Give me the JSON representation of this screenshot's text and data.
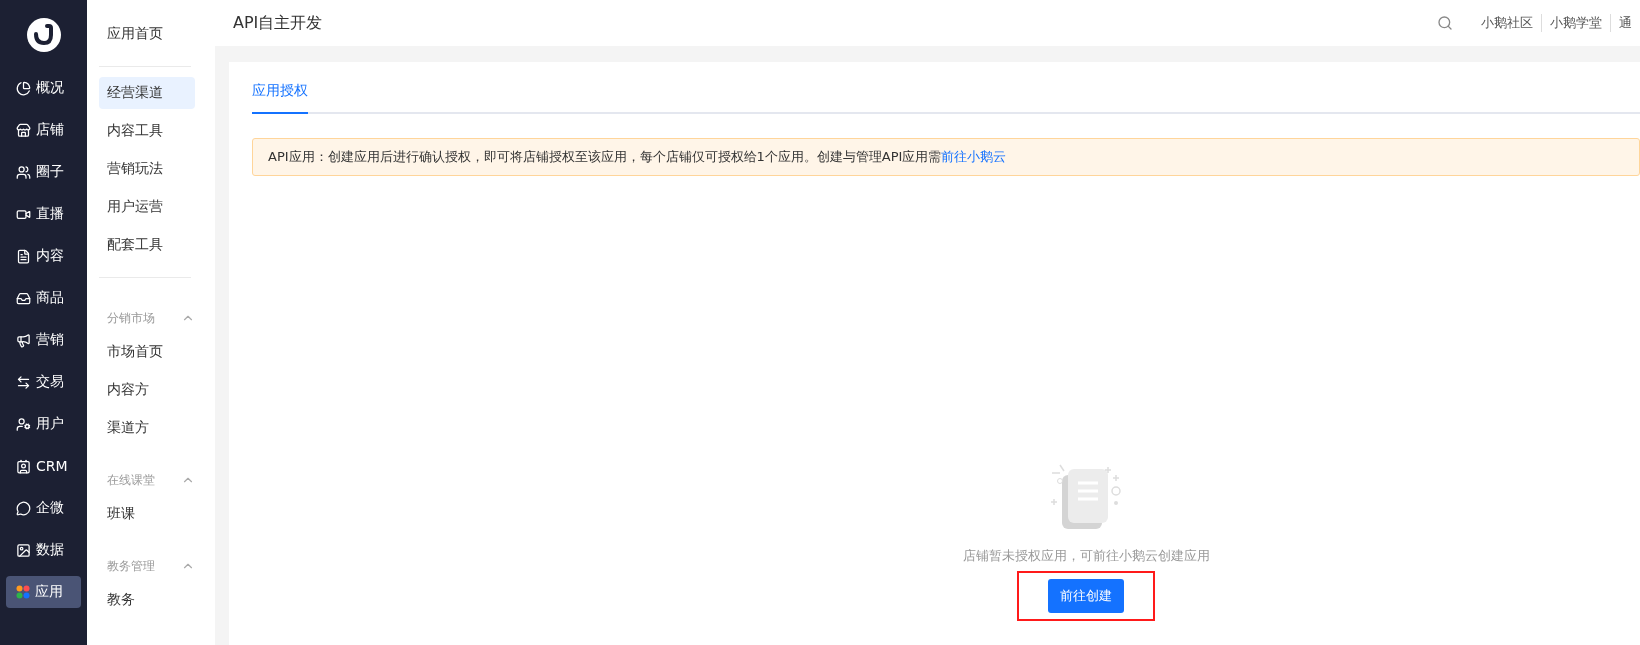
{
  "rail": {
    "items": [
      {
        "label": "概况",
        "selected": false
      },
      {
        "label": "店铺",
        "selected": false
      },
      {
        "label": "圈子",
        "selected": false
      },
      {
        "label": "直播",
        "selected": false
      },
      {
        "label": "内容",
        "selected": false
      },
      {
        "label": "商品",
        "selected": false
      },
      {
        "label": "营销",
        "selected": false
      },
      {
        "label": "交易",
        "selected": false
      },
      {
        "label": "用户",
        "selected": false
      },
      {
        "label": "CRM",
        "selected": false
      },
      {
        "label": "企微",
        "selected": false
      },
      {
        "label": "数据",
        "selected": false
      },
      {
        "label": "应用",
        "selected": true
      }
    ]
  },
  "sidebar": {
    "groups": [
      {
        "items": [
          {
            "label": "应用首页",
            "selected": false
          }
        ]
      },
      {
        "items": [
          {
            "label": "经营渠道",
            "selected": true
          },
          {
            "label": "内容工具",
            "selected": false
          },
          {
            "label": "营销玩法",
            "selected": false
          },
          {
            "label": "用户运营",
            "selected": false
          },
          {
            "label": "配套工具",
            "selected": false
          }
        ]
      },
      {
        "title": "分销市场",
        "expanded": true,
        "items": [
          {
            "label": "市场首页",
            "selected": false
          },
          {
            "label": "内容方",
            "selected": false
          },
          {
            "label": "渠道方",
            "selected": false
          }
        ]
      },
      {
        "title": "在线课堂",
        "expanded": true,
        "items": [
          {
            "label": "班课",
            "selected": false
          }
        ]
      },
      {
        "title": "教务管理",
        "expanded": true,
        "items": [
          {
            "label": "教务",
            "selected": false
          }
        ]
      }
    ]
  },
  "header": {
    "title": "API自主开发",
    "links": [
      "小鹅社区",
      "小鹅学堂",
      "通"
    ]
  },
  "tabs": [
    {
      "label": "应用授权",
      "selected": true
    }
  ],
  "notice": {
    "text": "API应用：创建应用后进行确认授权，即可将店铺授权至该应用，每个店铺仅可授权给1个应用。创建与管理API应用需",
    "link": "前往小鹅云"
  },
  "empty_state": {
    "message": "店铺暂未授权应用，可前往小鹅云创建应用",
    "button": "前往创建",
    "highlighted": true
  }
}
